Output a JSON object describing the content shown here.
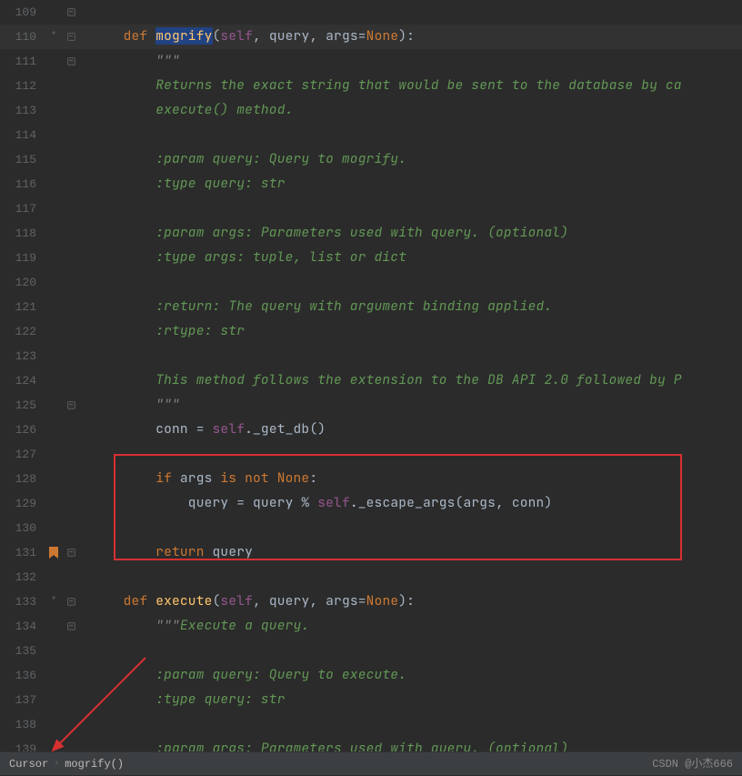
{
  "linesStart": 109,
  "lines": [
    {
      "n": 109,
      "marker": "",
      "fold": "close",
      "tokens": []
    },
    {
      "n": 110,
      "marker": "*",
      "fold": "open",
      "hl": true,
      "tokens": [
        {
          "c": "kw",
          "t": "    def "
        },
        {
          "c": "fn-sel",
          "t": "mogrify"
        },
        {
          "c": "op",
          "t": "("
        },
        {
          "c": "self",
          "t": "self"
        },
        {
          "c": "op",
          "t": ", "
        },
        {
          "c": "param",
          "t": "query"
        },
        {
          "c": "op",
          "t": ", "
        },
        {
          "c": "param",
          "t": "args"
        },
        {
          "c": "op",
          "t": "="
        },
        {
          "c": "none",
          "t": "None"
        },
        {
          "c": "op",
          "t": "):"
        }
      ]
    },
    {
      "n": 111,
      "fold": "open",
      "tokens": [
        {
          "c": "str",
          "t": "        \"\"\""
        }
      ]
    },
    {
      "n": 112,
      "tokens": [
        {
          "c": "docstr",
          "t": "        Returns the exact string that would be sent to the database by ca"
        }
      ]
    },
    {
      "n": 113,
      "tokens": [
        {
          "c": "docstr",
          "t": "        execute() method."
        }
      ]
    },
    {
      "n": 114,
      "tokens": []
    },
    {
      "n": 115,
      "tokens": [
        {
          "c": "docstr",
          "t": "        :param query: Query to mogrify."
        }
      ]
    },
    {
      "n": 116,
      "tokens": [
        {
          "c": "docstr",
          "t": "        :type query: str"
        }
      ]
    },
    {
      "n": 117,
      "tokens": []
    },
    {
      "n": 118,
      "tokens": [
        {
          "c": "docstr",
          "t": "        :param args: Parameters used with query. (optional)"
        }
      ]
    },
    {
      "n": 119,
      "tokens": [
        {
          "c": "docstr",
          "t": "        :type args: tuple, list or dict"
        }
      ]
    },
    {
      "n": 120,
      "tokens": []
    },
    {
      "n": 121,
      "tokens": [
        {
          "c": "docstr",
          "t": "        :return: The query with argument binding applied."
        }
      ]
    },
    {
      "n": 122,
      "tokens": [
        {
          "c": "docstr",
          "t": "        :rtype: str"
        }
      ]
    },
    {
      "n": 123,
      "tokens": []
    },
    {
      "n": 124,
      "tokens": [
        {
          "c": "docstr",
          "t": "        This method follows the extension to the DB API 2.0 followed by P"
        }
      ]
    },
    {
      "n": 125,
      "fold": "close",
      "tokens": [
        {
          "c": "str",
          "t": "        \"\"\""
        }
      ]
    },
    {
      "n": 126,
      "tokens": [
        {
          "c": "ident",
          "t": "        conn "
        },
        {
          "c": "op",
          "t": "= "
        },
        {
          "c": "self",
          "t": "self"
        },
        {
          "c": "op",
          "t": "._get_db()"
        }
      ]
    },
    {
      "n": 127,
      "tokens": []
    },
    {
      "n": 128,
      "tokens": [
        {
          "c": "ident",
          "t": "        "
        },
        {
          "c": "kw",
          "t": "if "
        },
        {
          "c": "ident",
          "t": "args "
        },
        {
          "c": "kw",
          "t": "is not "
        },
        {
          "c": "none",
          "t": "None"
        },
        {
          "c": "op",
          "t": ":"
        }
      ]
    },
    {
      "n": 129,
      "tokens": [
        {
          "c": "ident",
          "t": "            query "
        },
        {
          "c": "op",
          "t": "= "
        },
        {
          "c": "ident",
          "t": "query "
        },
        {
          "c": "op",
          "t": "% "
        },
        {
          "c": "self",
          "t": "self"
        },
        {
          "c": "op",
          "t": "._escape_args(args"
        },
        {
          "c": "op",
          "t": ", "
        },
        {
          "c": "ident",
          "t": "conn)"
        }
      ]
    },
    {
      "n": 130,
      "tokens": []
    },
    {
      "n": 131,
      "bookmark": true,
      "fold": "close",
      "tokens": [
        {
          "c": "ident",
          "t": "        "
        },
        {
          "c": "kw",
          "t": "return "
        },
        {
          "c": "ident",
          "t": "query"
        }
      ]
    },
    {
      "n": 132,
      "tokens": []
    },
    {
      "n": 133,
      "marker": "*",
      "fold": "open",
      "tokens": [
        {
          "c": "kw",
          "t": "    def "
        },
        {
          "c": "fn",
          "t": "execute"
        },
        {
          "c": "op",
          "t": "("
        },
        {
          "c": "self",
          "t": "self"
        },
        {
          "c": "op",
          "t": ", "
        },
        {
          "c": "param",
          "t": "query"
        },
        {
          "c": "op",
          "t": ", "
        },
        {
          "c": "param",
          "t": "args"
        },
        {
          "c": "op",
          "t": "="
        },
        {
          "c": "none",
          "t": "None"
        },
        {
          "c": "op",
          "t": "):"
        }
      ]
    },
    {
      "n": 134,
      "fold": "open",
      "tokens": [
        {
          "c": "str",
          "t": "        \"\"\""
        },
        {
          "c": "docstr",
          "t": "Execute a query."
        }
      ]
    },
    {
      "n": 135,
      "tokens": []
    },
    {
      "n": 136,
      "tokens": [
        {
          "c": "docstr",
          "t": "        :param query: Query to execute."
        }
      ]
    },
    {
      "n": 137,
      "tokens": [
        {
          "c": "docstr",
          "t": "        :type query: str"
        }
      ]
    },
    {
      "n": 138,
      "tokens": []
    },
    {
      "n": 139,
      "tokens": [
        {
          "c": "docstr",
          "t": "        :param args: Parameters used with query. (optional)"
        }
      ]
    }
  ],
  "breadcrumb": {
    "item1": "Cursor",
    "item2": "mogrify()"
  },
  "watermark": "CSDN @小杰666"
}
